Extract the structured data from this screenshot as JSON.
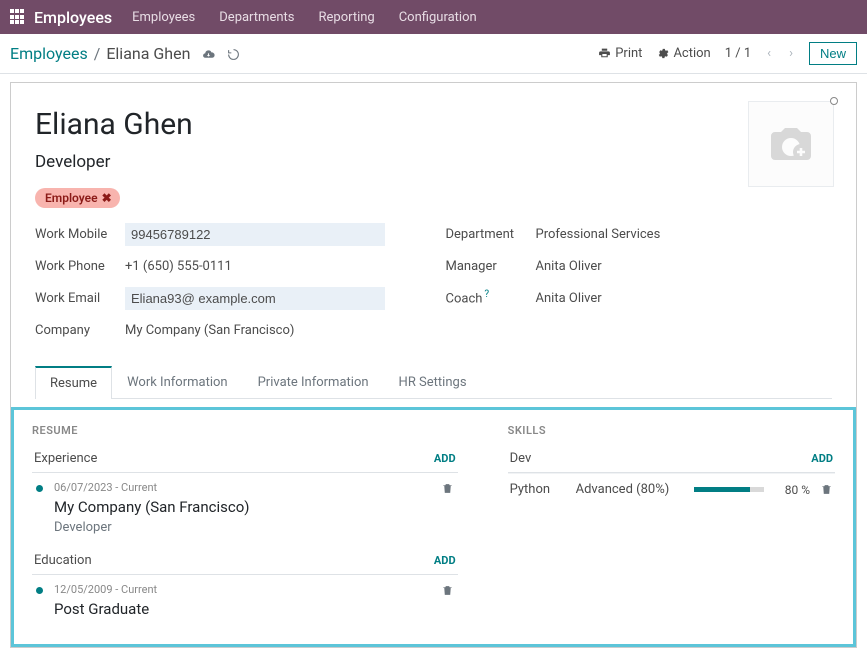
{
  "navbar": {
    "brand": "Employees",
    "items": [
      "Employees",
      "Departments",
      "Reporting",
      "Configuration"
    ]
  },
  "control_panel": {
    "breadcrumb_root": "Employees",
    "breadcrumb_current": "Eliana Ghen",
    "print_label": "Print",
    "action_label": "Action",
    "pager": "1 / 1",
    "new_label": "New"
  },
  "form": {
    "name": "Eliana Ghen",
    "job_title": "Developer",
    "tag_label": "Employee",
    "fields": {
      "work_mobile_label": "Work Mobile",
      "work_mobile_value": "99456789122",
      "work_phone_label": "Work Phone",
      "work_phone_value": "+1 (650) 555-0111",
      "work_email_label": "Work Email",
      "work_email_value": "Eliana93@ example.com",
      "company_label": "Company",
      "company_value": "My Company (San Francisco)",
      "department_label": "Department",
      "department_value": "Professional Services",
      "manager_label": "Manager",
      "manager_value": "Anita Oliver",
      "coach_label": "Coach",
      "coach_value": "Anita Oliver"
    }
  },
  "tabs": [
    "Resume",
    "Work Information",
    "Private Information",
    "HR Settings"
  ],
  "resume": {
    "section_title": "RESUME",
    "add_label": "ADD",
    "groups": [
      {
        "title": "Experience",
        "items": [
          {
            "dates": "06/07/2023 - Current",
            "title": "My Company (San Francisco)",
            "subtitle": "Developer"
          }
        ]
      },
      {
        "title": "Education",
        "items": [
          {
            "dates": "12/05/2009 - Current",
            "title": "Post Graduate",
            "subtitle": ""
          }
        ]
      }
    ]
  },
  "skills": {
    "section_title": "SKILLS",
    "add_label": "ADD",
    "group_title": "Dev",
    "items": [
      {
        "name": "Python",
        "level_label": "Advanced (80%)",
        "pct": 80,
        "pct_label": "80 %"
      }
    ]
  }
}
